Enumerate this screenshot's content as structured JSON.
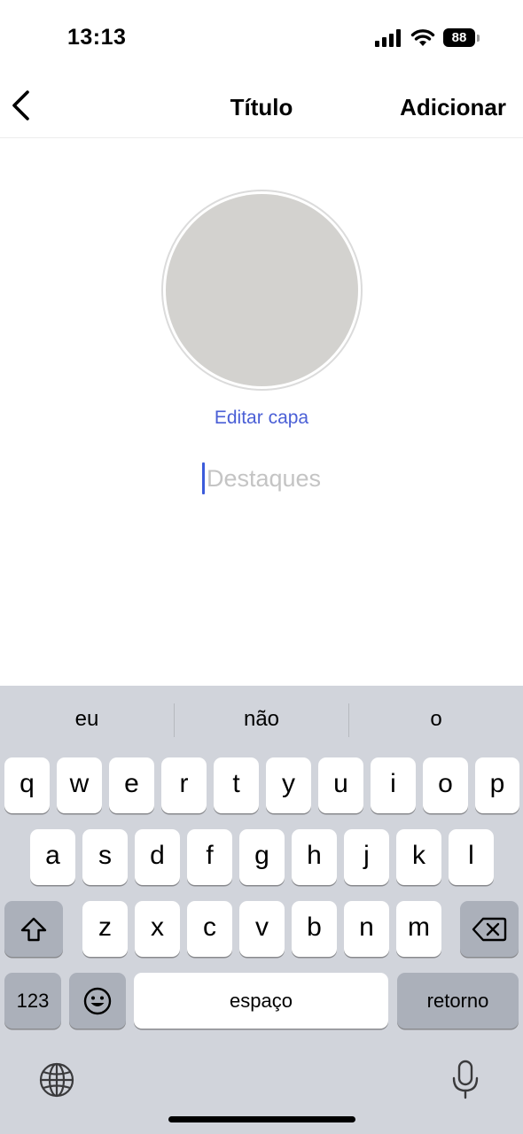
{
  "status_bar": {
    "time": "13:13",
    "battery_level": "88",
    "icons": [
      "cellular-signal-icon",
      "wifi-icon",
      "battery-icon"
    ]
  },
  "nav": {
    "back_icon": "chevron-left-icon",
    "title": "Título",
    "action_label": "Adicionar"
  },
  "cover": {
    "edit_label": "Editar capa",
    "placeholder_color": "#d3d2cf"
  },
  "highlight_name": {
    "placeholder": "Destaques",
    "value": ""
  },
  "keyboard": {
    "suggestions": [
      "eu",
      "não",
      "o"
    ],
    "row1": [
      "q",
      "w",
      "e",
      "r",
      "t",
      "y",
      "u",
      "i",
      "o",
      "p"
    ],
    "row2": [
      "a",
      "s",
      "d",
      "f",
      "g",
      "h",
      "j",
      "k",
      "l"
    ],
    "row3": [
      "z",
      "x",
      "c",
      "v",
      "b",
      "n",
      "m"
    ],
    "numbers_label": "123",
    "space_label": "espaço",
    "return_label": "retorno",
    "icons": [
      "shift-icon",
      "delete-icon",
      "emoji-icon",
      "globe-icon",
      "microphone-icon"
    ]
  },
  "colors": {
    "accent": "#4a5fd6",
    "keyboard_bg": "#d1d4db",
    "function_key": "#abb0ba"
  }
}
